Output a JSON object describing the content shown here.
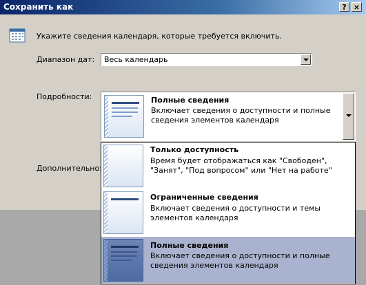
{
  "window": {
    "title": "Сохранить как",
    "help_glyph": "?",
    "close_glyph": "×"
  },
  "dialog": {
    "intro_text": "Укажите сведения календаря, которые требуется включить.",
    "date_range_label": "Диапазон дат:",
    "date_range_value": "Весь календарь",
    "details_label": "Подробности:",
    "advanced_label": "Дополнительно:"
  },
  "details_selected": {
    "title": "Полные сведения",
    "description": "Включает сведения о доступности и полные сведения элементов календаря"
  },
  "dropdown_options": [
    {
      "title": "Только доступность",
      "description": "Время будет отображаться как \"Свободен\", \"Занят\", \"Под вопросом\" или \"Нет на работе\"",
      "selected": false
    },
    {
      "title": "Ограниченные сведения",
      "description": "Включает сведения о доступности и темы элементов календаря",
      "selected": false
    },
    {
      "title": "Полные сведения",
      "description": "Включает сведения о доступности и полные сведения элементов календаря",
      "selected": true
    }
  ],
  "colors": {
    "titlebar": "#0a246a",
    "dialog_bg": "#d4d0c8",
    "highlight": "#a9b3cf"
  }
}
